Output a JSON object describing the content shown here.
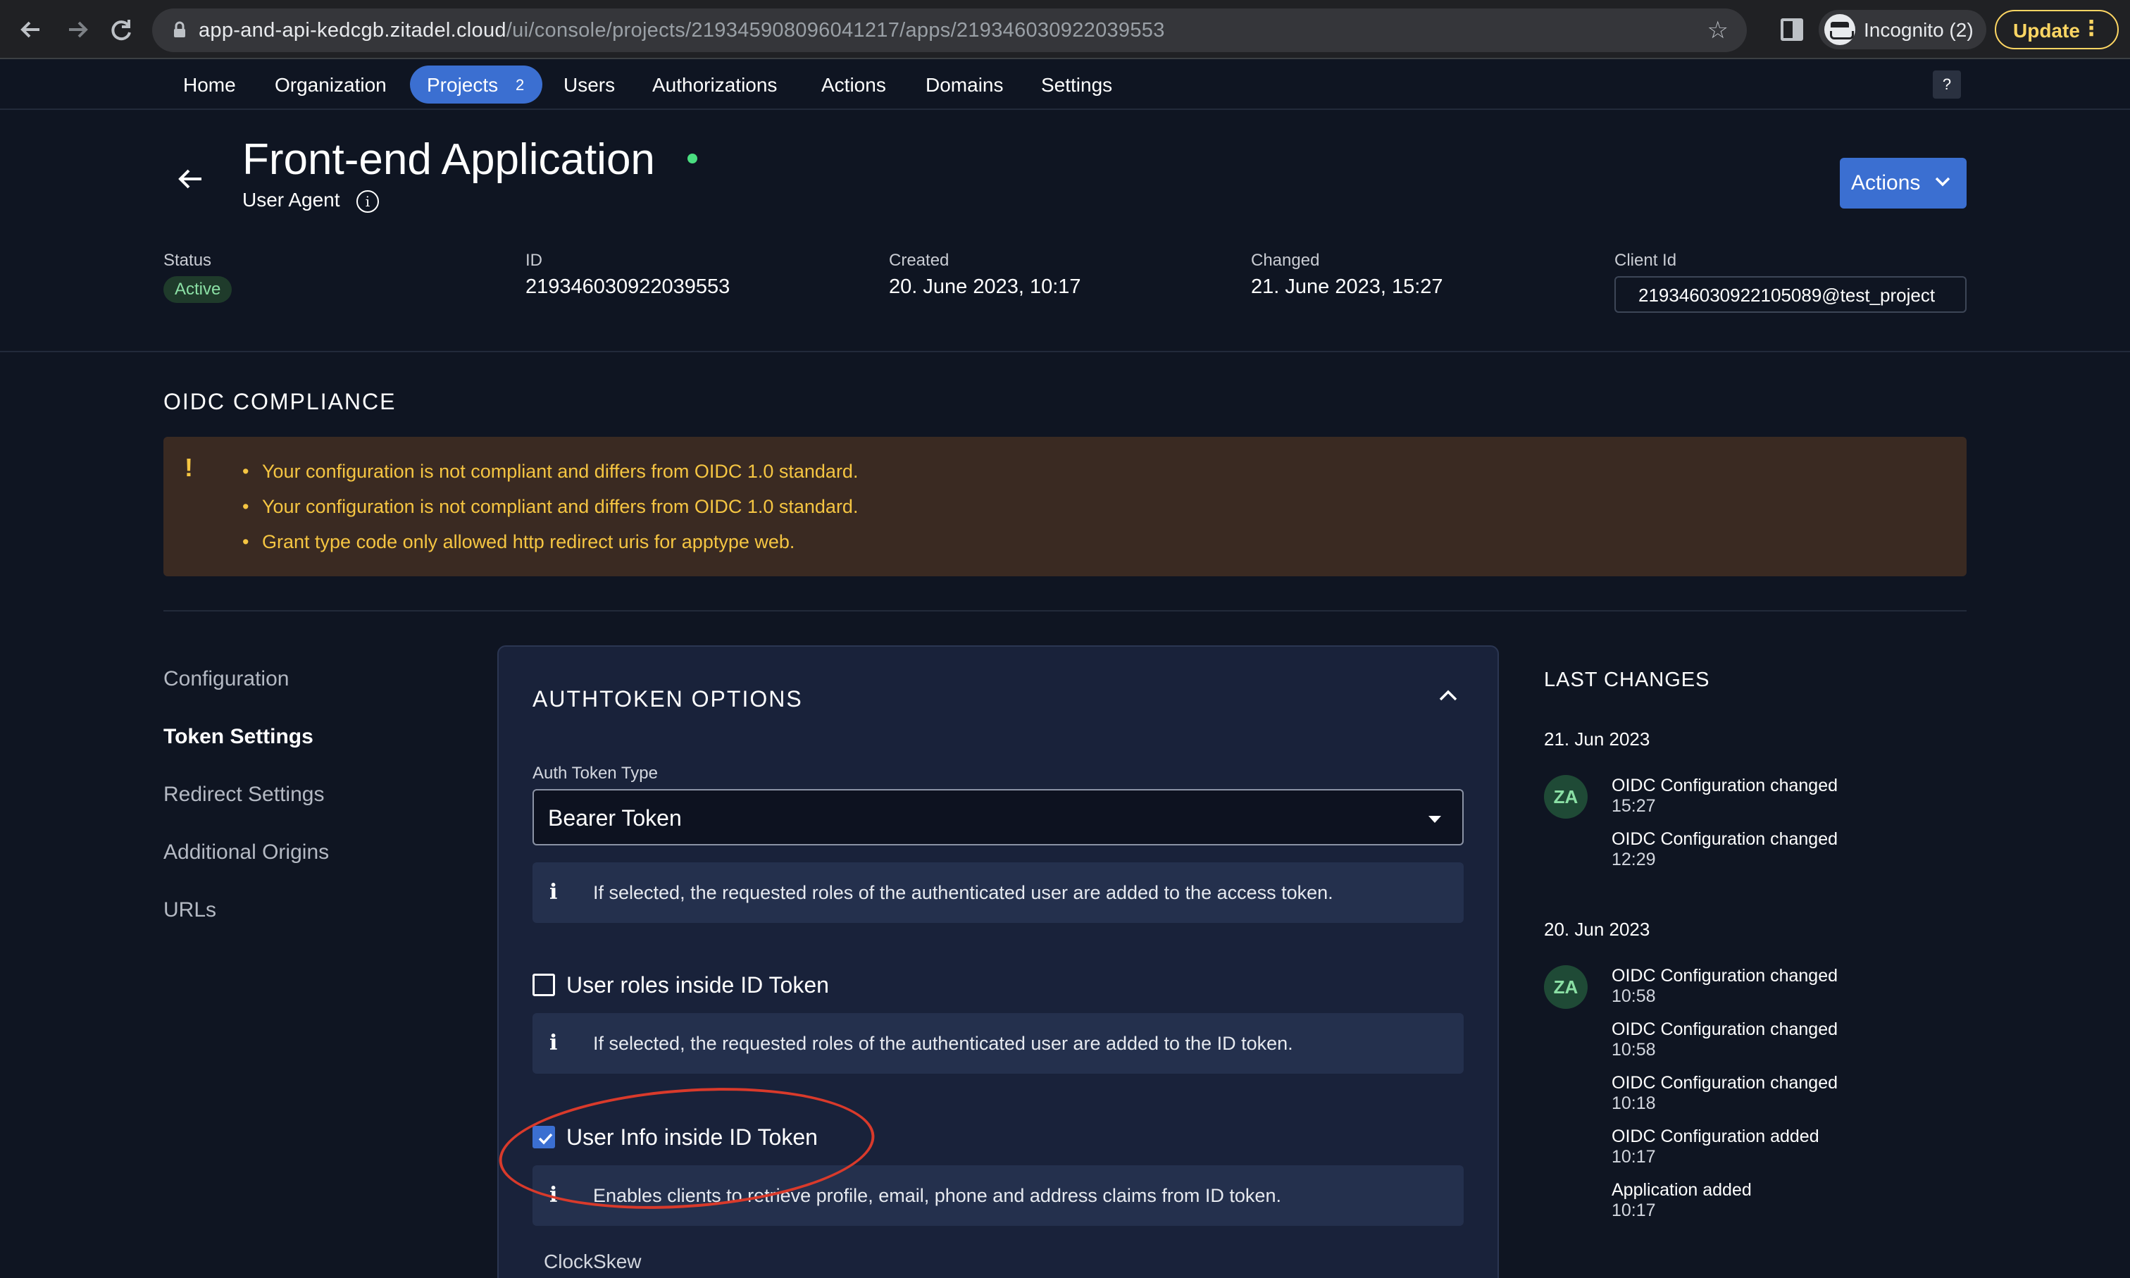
{
  "browser": {
    "url_host": "app-and-api-kedcgb.zitadel.cloud",
    "url_path": "/ui/console/projects/219345908096041217/apps/219346030922039553",
    "incognito_label": "Incognito (2)",
    "update_label": "Update",
    "update_menu": "⋮"
  },
  "nav": {
    "home": "Home",
    "organization": "Organization",
    "projects": "Projects",
    "projects_count": "2",
    "users": "Users",
    "authorizations": "Authorizations",
    "actions": "Actions",
    "domains": "Domains",
    "settings": "Settings",
    "help": "?"
  },
  "header": {
    "title": "Front-end Application",
    "subtitle": "User Agent",
    "info_glyph": "i",
    "actions_label": "Actions"
  },
  "meta": {
    "status_label": "Status",
    "status_value": "Active",
    "id_label": "ID",
    "id_value": "219346030922039553",
    "created_label": "Created",
    "created_value": "20. June 2023, 10:17",
    "changed_label": "Changed",
    "changed_value": "21. June 2023, 15:27",
    "client_id_label": "Client Id",
    "client_id_value": "219346030922105089@test_project"
  },
  "compliance": {
    "heading": "OIDC COMPLIANCE",
    "icon": "!",
    "bullet": "•",
    "items": [
      "Your configuration is not compliant and differs from OIDC 1.0 standard.",
      "Your configuration is not compliant and differs from OIDC 1.0 standard.",
      "Grant type code only allowed http redirect uris for apptype web."
    ]
  },
  "sidenav": {
    "items": [
      "Configuration",
      "Token Settings",
      "Redirect Settings",
      "Additional Origins",
      "URLs"
    ],
    "active": "Token Settings"
  },
  "authtoken": {
    "title": "AUTHTOKEN OPTIONS",
    "type_label": "Auth Token Type",
    "type_value": "Bearer Token",
    "hint_glyph": "i",
    "hint_access": "If selected, the requested roles of the authenticated user are added to the access token.",
    "roles_label": "User roles inside ID Token",
    "roles_checked": false,
    "hint_id": "If selected, the requested roles of the authenticated user are added to the ID token.",
    "userinfo_label": "User Info inside ID Token",
    "userinfo_checked": true,
    "hint_userinfo": "Enables clients to retrieve profile, email, phone and address claims from ID token.",
    "clockskew_label": "ClockSkew"
  },
  "last_changes": {
    "heading": "LAST CHANGES",
    "groups": [
      {
        "date": "21. Jun 2023",
        "avatar": "ZA",
        "entries": [
          {
            "title": "OIDC Configuration changed",
            "time": "15:27"
          },
          {
            "title": "OIDC Configuration changed",
            "time": "12:29"
          }
        ]
      },
      {
        "date": "20. Jun 2023",
        "avatar": "ZA",
        "entries": [
          {
            "title": "OIDC Configuration changed",
            "time": "10:58"
          },
          {
            "title": "OIDC Configuration changed",
            "time": "10:58"
          },
          {
            "title": "OIDC Configuration changed",
            "time": "10:18"
          },
          {
            "title": "OIDC Configuration added",
            "time": "10:17"
          },
          {
            "title": "Application added",
            "time": "10:17"
          }
        ]
      }
    ]
  },
  "colors": {
    "accent": "#3b6fd1",
    "background": "#0f1522",
    "warning_text": "#f5c542",
    "warning_bg": "#3a2a22",
    "annotation": "#d93a2b"
  }
}
